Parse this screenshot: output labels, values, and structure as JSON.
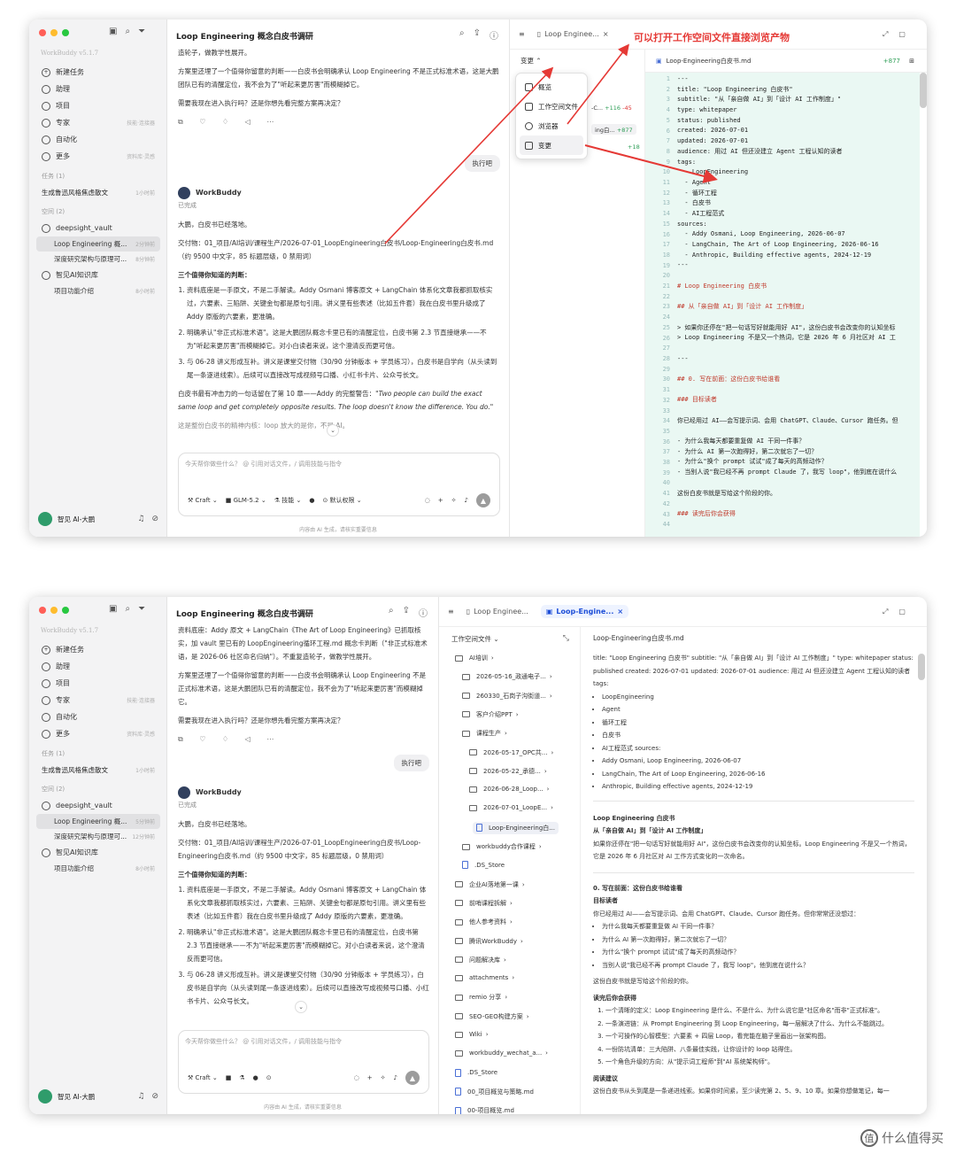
{
  "brand": "WorkBuddy v5.1.7",
  "nav": [
    {
      "label": "新建任务",
      "hint": ""
    },
    {
      "label": "助理",
      "hint": ""
    },
    {
      "label": "项目",
      "hint": ""
    },
    {
      "label": "专家",
      "hint": "技能·连接器"
    },
    {
      "label": "自动化",
      "hint": ""
    },
    {
      "label": "更多",
      "hint": "资料库·灵感"
    }
  ],
  "tasks_group": "任务 (1)",
  "task": {
    "label": "生成鲁迅风格焦虑散文",
    "time": "1小时前"
  },
  "space_group": "空间 (2)",
  "space1": {
    "label": "deepsight_vault",
    "items": [
      {
        "label": "Loop Engineering 概...",
        "time1": "2分钟前",
        "time2": "5分钟前"
      },
      {
        "label": "深度研究架构与原理可...",
        "time1": "8分钟前",
        "time2": "12分钟前"
      }
    ]
  },
  "space2": {
    "label": "智见AI知识库",
    "items": [
      {
        "label": "项目功能介绍",
        "time": "8小时前"
      }
    ]
  },
  "user": "智见 AI-大鹏",
  "chat": {
    "title": "Loop Engineering 概念白皮书调研",
    "w1_top1": "造轮子，做教学性展开。",
    "w2_top1": "资料底座：Addy 原文 + LangChain《The Art of Loop Engineering》已抓取核实，加 vault 里已有的 LoopEngineering循环工程.md 概念卡判断（\"非正式标准术语，是 2026-06 社区命名归纳\"）。不重复造轮子，做教学性展开。",
    "p_judgment": "方案里还埋了一个值得你留意的判断——白皮书会明确承认 Loop Engineering 不是正式标准术语，这是大鹏团队已有的清醒定位，我不会为了\"听起来更厉害\"而模糊掉它。",
    "p_ask": "需要我现在进入执行吗？还是你想先看完整方案再决定？",
    "user_msg": "执行吧",
    "agent": "WorkBuddy",
    "done": "已完成",
    "landed": "大鹏，白皮书已经落地。",
    "deliver": "交付物：01_项目/AI培训/课程生产/2026-07-01_LoopEngineering白皮书/Loop-Engineering白皮书.md（约 9500 中文字，85 标题层级，0 禁用词）",
    "three": "三个值得你知道的判断：",
    "points": [
      "资料底座是一手原文，不是二手解读。Addy Osmani 博客原文 + LangChain 体系化文章我都抓取核实过，六要素、三陷阱、关键金句都是原句引用。讲义里有些表述（比如五件套）我在白皮书里升级成了 Addy 原版的六要素，更准确。",
      "明确承认\"非正式标准术语\"。这是大鹏团队概念卡里已有的清醒定位，白皮书第 2.3 节直接继承——不为\"听起来更厉害\"而模糊掉它。对小白读者来说，这个澄清反而更可信。",
      "与 06-28 讲义形成互补。讲义是课堂交付物（30/90 分钟版本 + 学员练习），白皮书是自学向（从头读到尾一条逐进线索）。后续可以直接改写成视频号口播、小红书卡片、公众号长文。"
    ],
    "quote_pre": "白皮书最有冲击力的一句话留在了第 10 章——Addy 的完整警告：",
    "quote": "\"Two people can build the exact same loop and get completely opposite results. The loop doesn't know the difference. You do.\"",
    "quote_post": "这是整份白皮书的精神内核：loop 放大的是你，不是 AI。",
    "input_ph": "今天帮你做些什么？ @ 引用对话文件，/ 调用技能与指令",
    "craft": "Craft",
    "model": "GLM-5.2",
    "skills": "技能",
    "perm": "默认权限",
    "disclaimer": "内容由 AI 生成，请核实重要信息"
  },
  "w1": {
    "tab": "Loop Enginee...",
    "annotation": "可以打开工作空间文件直接浏览产物",
    "change": "变更",
    "menu": [
      "概览",
      "工作空间文件",
      "浏览器",
      "变更"
    ],
    "rows": [
      {
        "label": "-C...",
        "add": "+116",
        "del": "-45"
      },
      {
        "label": "ing白...",
        "add": "+877",
        "del": ""
      },
      {
        "label": "",
        "add": "+18",
        "del": ""
      }
    ],
    "file": "Loop-Engineering白皮书.md",
    "diff": "+877",
    "code": [
      "---",
      "title: \"Loop Engineering 白皮书\"",
      "subtitle: \"从「亲自做 AI」到「设计 AI 工作制度」\"",
      "type: whitepaper",
      "status: published",
      "created: 2026-07-01",
      "updated: 2026-07-01",
      "audience: 用过 AI 但还没建立 Agent 工程认知的读者",
      "tags:",
      "  - LoopEngineering",
      "  - Agent",
      "  - 循环工程",
      "  - 白皮书",
      "  - AI工程范式",
      "sources:",
      "  - Addy Osmani, Loop Engineering, 2026-06-07",
      "  - LangChain, The Art of Loop Engineering, 2026-06-16",
      "  - Anthropic, Building effective agents, 2024-12-19",
      "---",
      "",
      "# Loop Engineering 白皮书",
      "",
      "## 从「亲自做 AI」到「设计 AI 工作制度」",
      "",
      "> 如果你还停在\"把一句话写好就能用好 AI\"，这份白皮书会改变你的认知坐标",
      "> Loop Engineering 不是又一个热词，它是 2026 年 6 月社区对 AI 工",
      "",
      "---",
      "",
      "## 0. 写在前面：这份白皮书给谁看",
      "",
      "### 目标读者",
      "",
      "你已经用过 AI——会写提示词、会用 ChatGPT、Claude、Cursor 跑任务。但",
      "",
      "- 为什么我每天都要重复做 AI 干同一件事？",
      "- 为什么 AI 第一次跑得好，第二次就忘了一切？",
      "- 为什么\"换个 prompt 试试\"成了每天的高频动作？",
      "- 当别人说\"我已经不再 prompt Claude 了，我写 loop\"，他到底在说什么",
      "",
      "这份白皮书就是写给这个阶段的你。",
      "",
      "### 读完后你会获得",
      ""
    ]
  },
  "w2": {
    "tab1": "Loop Enginee...",
    "tab2": "Loop-Engine...",
    "tree_head": "工作空间文件",
    "tree": [
      {
        "label": "AI培训",
        "file": false,
        "indent": 0
      },
      {
        "label": "2026-05-16_政通电子...",
        "file": false,
        "indent": 1
      },
      {
        "label": "260330_石岗子沟街道...",
        "file": false,
        "indent": 1
      },
      {
        "label": "客户介绍PPT",
        "file": false,
        "indent": 1
      },
      {
        "label": "课程生产",
        "file": false,
        "indent": 1
      },
      {
        "label": "2026-05-17_OPC共...",
        "file": false,
        "indent": 2
      },
      {
        "label": "2026-05-22_承德...",
        "file": false,
        "indent": 2
      },
      {
        "label": "2026-06-28_Loop...",
        "file": false,
        "indent": 2
      },
      {
        "label": "2026-07-01_LoopE...",
        "file": false,
        "indent": 2
      },
      {
        "label": "Loop-Engineering白...",
        "file": true,
        "indent": 3
      },
      {
        "label": "workbuddy合作课程",
        "file": false,
        "indent": 1
      },
      {
        "label": ".DS_Store",
        "file": true,
        "indent": 1
      },
      {
        "label": "企业AI落地第一课",
        "file": false,
        "indent": 0
      },
      {
        "label": "前哨课程拆解",
        "file": false,
        "indent": 0
      },
      {
        "label": "他人参考资料",
        "file": false,
        "indent": 0
      },
      {
        "label": "腾讯WorkBuddy",
        "file": false,
        "indent": 0
      },
      {
        "label": "问题解决库",
        "file": false,
        "indent": 0
      },
      {
        "label": "attachments",
        "file": false,
        "indent": 0
      },
      {
        "label": "remio 分享",
        "file": false,
        "indent": 0
      },
      {
        "label": "SEO-GEO构建方案",
        "file": false,
        "indent": 0
      },
      {
        "label": "Wiki",
        "file": false,
        "indent": 0
      },
      {
        "label": "workbuddy_wechat_a...",
        "file": false,
        "indent": 0
      },
      {
        "label": ".DS_Store",
        "file": true,
        "indent": 0
      },
      {
        "label": "00_项目概览与策略.md",
        "file": true,
        "indent": 0
      },
      {
        "label": "00-项目概览.md",
        "file": true,
        "indent": 0
      }
    ],
    "pv_title": "Loop-Engineering白皮书.md",
    "meta": "title: \"Loop Engineering 白皮书\" subtitle: \"从「亲自做 AI」到「设计 AI 工作制度」\" type: whitepaper status: published created: 2026-07-01 updated: 2026-07-01 audience: 用过 AI 但还没建立 Agent 工程认知的读者 tags:",
    "tags": [
      "LoopEngineering",
      "Agent",
      "循环工程",
      "白皮书",
      "AI工程范式 sources:",
      "Addy Osmani, Loop Engineering, 2026-06-07",
      "LangChain, The Art of Loop Engineering, 2026-06-16",
      "Anthropic, Building effective agents, 2024-12-19"
    ],
    "h1": "Loop Engineering 白皮书",
    "h2": "从「亲自做 AI」到「设计 AI 工作制度」",
    "intro": "如果你还停在\"把一句话写好就能用好 AI\"，这份白皮书会改变你的认知坐标。Loop Engineering 不是又一个热词，它是 2026 年 6 月社区对 AI 工作方式变化的一次命名。",
    "s0": "0. 写在前面：这份白皮书给谁看",
    "reader": "目标读者",
    "reader_p": "你已经用过 AI——会写提示词、会用 ChatGPT、Claude、Cursor 跑任务。但你常常还没想过：",
    "qs": [
      "为什么我每天都要重复做 AI 干同一件事？",
      "为什么 AI 第一次跑得好，第二次就忘了一切？",
      "为什么\"换个 prompt 试试\"成了每天的高频动作？",
      "当别人说\"我已经不再 prompt Claude 了，我写 loop\"，他到底在说什么？"
    ],
    "for_you": "这份白皮书就是写给这个阶段的你。",
    "gain": "读完后你会获得",
    "gains": [
      "一个清晰的定义：Loop Engineering 是什么、不是什么、为什么说它是\"社区命名\"而非\"正式标准\"。",
      "一条演进链：从 Prompt Engineering 到 Loop Engineering，每一层解决了什么、为什么不能跳过。",
      "一个可操作的心智模型：六要素 + 四层 Loop，看完能在脑子里画出一张架构图。",
      "一份防坑清单：三大陷阱、八条最佳实践，让你设计的 loop 站得住。",
      "一个角色升级的方向：从\"提示词工程师\"到\"AI 系统架构师\"。"
    ],
    "advice": "阅读建议",
    "advice_p": "这份白皮书从头到尾是一条递进线索。如果你时间紧，至少读完第 2、5、9、10 章。如果你想做笔记，每一"
  },
  "watermark": "什么值得买"
}
